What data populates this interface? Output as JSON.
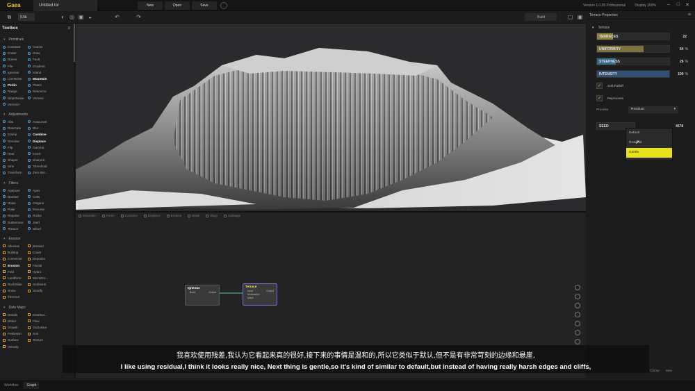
{
  "app": {
    "name": "Gaea",
    "file": "Untitled.tor",
    "version": "Version 1.0.28 Professional",
    "display_label": "Display",
    "display_zoom": "100%"
  },
  "menu": {
    "new": "New",
    "open": "Open",
    "save": "Save"
  },
  "toolbar": {
    "resolution": "0.5k",
    "build": "Build"
  },
  "toolbox": {
    "title": "Toolbox",
    "categories": [
      {
        "name": "Primitives",
        "color": "#4fa3d9",
        "items": [
          "Constant",
          "Cracks",
          "Crater",
          "Draw",
          "Dunes",
          "Fault",
          "File",
          "Gradient",
          "Igneous",
          "Island",
          "LineNoise",
          "Mountain",
          "Perlin",
          "Plates",
          "Range",
          "Resource",
          "SlopeNoise",
          "Voronoi",
          "Voronoi+"
        ]
      },
      {
        "name": "Adjustments",
        "color": "#4fa3d9",
        "items": [
          "Abs",
          "AutoLevel",
          "RiseGate",
          "Blur",
          "Clamp",
          "Combine",
          "Denoise",
          "Displace",
          "Flip",
          "Gamma",
          "Heal",
          "Invert",
          "Shaper",
          "Sharpen",
          "Sine",
          "Threshold",
          "Transform",
          "Zero Bor..."
        ]
      },
      {
        "name": "Filters",
        "color": "#4fa3d9",
        "items": [
          "Aperture",
          "Apex",
          "Bomber",
          "Cells",
          "Noise",
          "Origami",
          "Polar",
          "Recurse",
          "Repulse",
          "Rocks",
          "Subterrace",
          "Swirl",
          "Terrace",
          "Whorl"
        ]
      },
      {
        "name": "Erosion",
        "color": "#d9a23f",
        "items": [
          "Alluvium",
          "Breaker",
          "Buildup",
          "Coast",
          "Convector",
          "Deposits",
          "Erosion",
          "Fluvial",
          "Fold",
          "Hydro",
          "Landform",
          "MicroEro...",
          "RockSlide",
          "Sediment",
          "Snow",
          "Stratify",
          "Thermal"
        ]
      },
      {
        "name": "Data Maps",
        "color": "#d9a23f",
        "items": [
          "Details",
          "Distribut...",
          "Dither",
          "Flow",
          "Growth",
          "Occlusion",
          "Peklosion",
          "Soil",
          "Surface",
          "Texture",
          "Velocity"
        ]
      }
    ]
  },
  "graph_toolbar": [
    "Mountain",
    "Perlin",
    "Combine",
    "Displace",
    "Erosion",
    "Mask",
    "Warp",
    "SatMaps"
  ],
  "nodes": [
    {
      "title": "Igneous",
      "port_in": "Build",
      "port_out": "Output"
    },
    {
      "title": "Terrace",
      "inputs": [
        "Input",
        "Modulation",
        "Mask"
      ],
      "port_out": "Output"
    }
  ],
  "properties": {
    "header": "Terrace Properties",
    "section": "Terrace",
    "sliders": [
      {
        "label": "TERRACES",
        "value": "22",
        "unit": "",
        "fill": 0.22,
        "color": "#e6c84a"
      },
      {
        "label": "UNIFORMITY",
        "value": "64",
        "unit": "%",
        "fill": 0.64,
        "color": "#bfae54"
      },
      {
        "label": "STEEPNESS",
        "value": "26",
        "unit": "%",
        "fill": 0.26,
        "color": "#3aa0e0"
      },
      {
        "label": "INTENSITY",
        "value": "100",
        "unit": "%",
        "fill": 1.0,
        "color": "#3a6fae"
      }
    ],
    "soft_falloff": "Soft Falloff",
    "reprocess": "Reprocess",
    "process_label": "Process",
    "process_value": "Residual",
    "seed_label": "SEED",
    "seed_value": "4678",
    "dropdown": [
      "Default",
      "Residual",
      "Gentle"
    ]
  },
  "bottom": {
    "workflow": "Workflow",
    "graph": "Graph",
    "clamp": "Clamp",
    "max": "Max"
  },
  "subtitles": {
    "zh": "我喜欢使用残差,我认为它看起来真的很好,接下来的事情是温和的,所以它类似于默认,但不是有非常苛刻的边缘和悬崖,",
    "en": "I like using residual,I think it looks really nice, Next thing is gentle,so it's kind of similar to default,but instead of having really harsh edges and cliffs,"
  }
}
